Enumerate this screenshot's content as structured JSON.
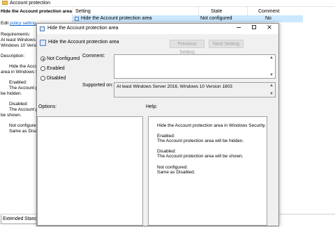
{
  "background_window": {
    "title": "Account protection",
    "left_pane": {
      "heading": "Hide the Account protection area",
      "edit_prefix": "Edit ",
      "edit_link": "policy setting",
      "requirements_label": "Requirements:",
      "requirements_line1": "At least Windows Se",
      "requirements_line2": "Windows 10 Version",
      "description_label": "Description:",
      "desc_line1": "Hide the Accou",
      "desc_line2": "area in Windows S",
      "enabled_label": "Enabled:",
      "enabled_line1": "The Account p",
      "enabled_line2": "be hidden.",
      "disabled_label": "Disabled:",
      "disabled_line1": "The Account p",
      "disabled_line2": "be shown.",
      "notconf_label": "Not configured",
      "notconf_line1": "Same as Disabl"
    },
    "columns": {
      "setting": "Setting",
      "state": "State",
      "comment": "Comment"
    },
    "row": {
      "setting": "Hide the Account protection area",
      "state": "Not configured",
      "comment": "No"
    },
    "tabs": [
      "Extended",
      "Standa"
    ]
  },
  "dialog": {
    "title": "Hide the Account protection area",
    "header_title": "Hide the Account protection area",
    "prev_button": "Previous Setting",
    "next_button": "Next Setting",
    "radios": [
      {
        "label": "Not Configured",
        "selected": true
      },
      {
        "label": "Enabled",
        "selected": false
      },
      {
        "label": "Disabled",
        "selected": false
      }
    ],
    "comment_label": "Comment:",
    "supported_label": "Supported on:",
    "supported_value": "At least Windows Server 2016, Windows 10 Version 1803",
    "options_label": "Options:",
    "help_label": "Help:",
    "help": {
      "line1": "Hide the Account protection area in Windows Security.",
      "enabled_label": "Enabled:",
      "enabled_text": "The Account protection area will be hidden.",
      "disabled_label": "Disabled:",
      "disabled_text": "The Account protection area will be shown.",
      "notconf_label": "Not configured:",
      "notconf_text": "Same as Disabled."
    }
  }
}
